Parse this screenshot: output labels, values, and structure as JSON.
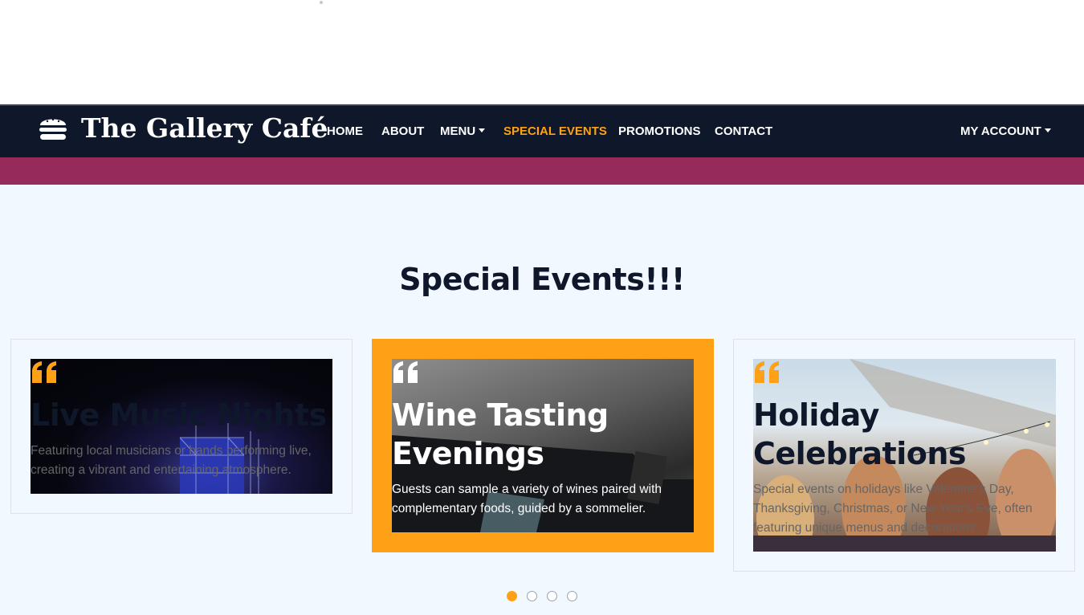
{
  "brand": {
    "name": "The Gallery Café",
    "icon": "burger-icon"
  },
  "nav": {
    "items": [
      {
        "label": "HOME"
      },
      {
        "label": "ABOUT"
      },
      {
        "label": "MENU"
      },
      {
        "label": "SPECIAL EVENTS",
        "active": true
      },
      {
        "label": "PROMOTIONS"
      },
      {
        "label": "CONTACT"
      }
    ],
    "account": "MY ACCOUNT"
  },
  "colors": {
    "navy": "#0f172b",
    "accent": "#fea116",
    "maroon": "#962a5a",
    "section_bg": "#f1f8ff"
  },
  "section": {
    "title": "Special Events!!!"
  },
  "events": [
    {
      "title": "Live Music Nights",
      "text": "Featuring local musicians or bands performing live, creating a vibrant and entertaining atmosphere.",
      "image": "concert-stage-photo"
    },
    {
      "title_line1": "Wine Tasting",
      "title_line2": "Evenings",
      "text": "Guests can sample a variety of wines paired with complementary foods, guided by a sommelier.",
      "image": "wine-bottle-photo"
    },
    {
      "title_line1": "Holiday",
      "title_line2": "Celebrations",
      "text": "Special events on holidays like Valentine's Day, Thanksgiving, Christmas, or New Year's Eve, often featuring unique menus and decorations.",
      "image": "friends-celebrating-photo"
    }
  ],
  "carousel": {
    "pages": 4,
    "current": 1
  }
}
